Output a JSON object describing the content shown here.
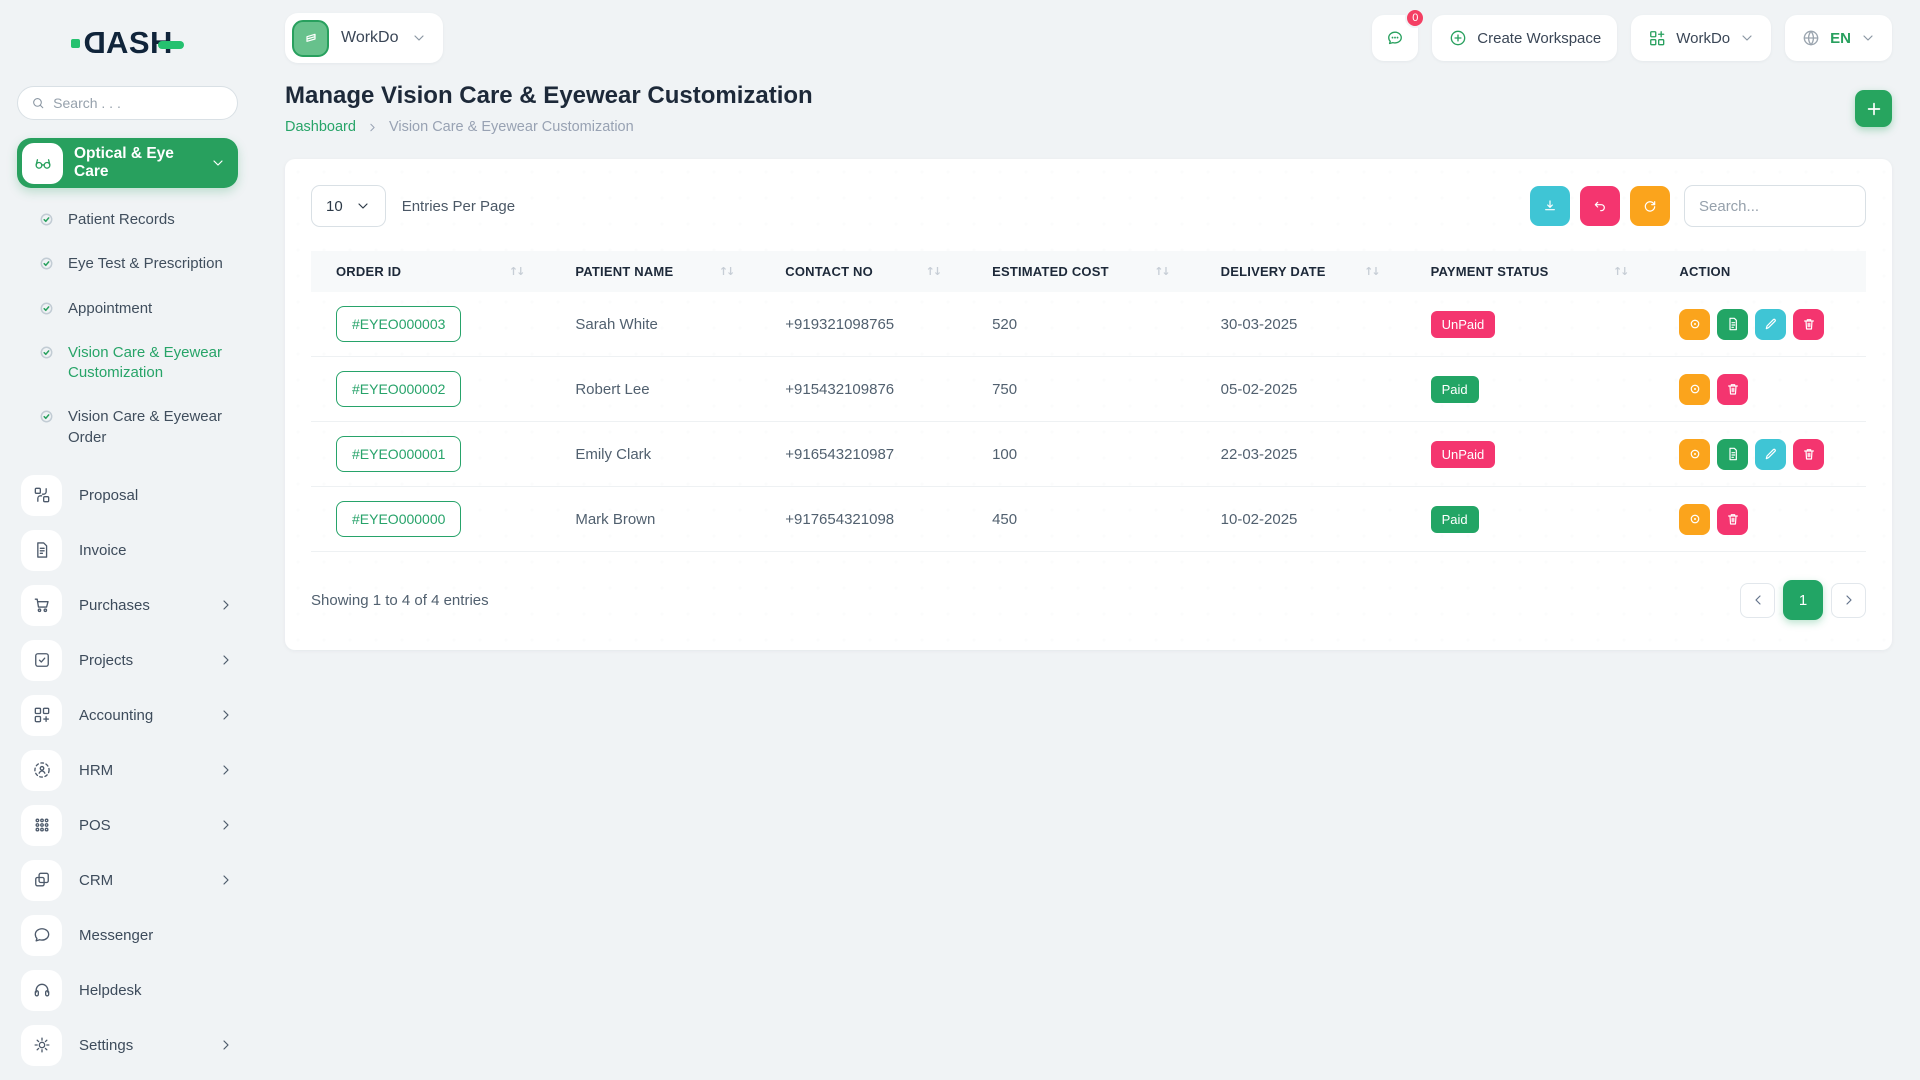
{
  "brand": {
    "name": "DASH"
  },
  "sidebar": {
    "search_placeholder": "Search . . .",
    "module": {
      "label": "Optical & Eye Care"
    },
    "submenu": [
      {
        "label": "Patient Records"
      },
      {
        "label": "Eye Test & Prescription"
      },
      {
        "label": "Appointment"
      },
      {
        "label": "Vision Care & Eyewear Customization",
        "active": true
      },
      {
        "label": "Vision Care & Eyewear Order"
      }
    ],
    "menu": [
      {
        "label": "Proposal",
        "icon": "proposal-icon",
        "has_submenu": false
      },
      {
        "label": "Invoice",
        "icon": "invoice-icon",
        "has_submenu": false
      },
      {
        "label": "Purchases",
        "icon": "purchases-icon",
        "has_submenu": true
      },
      {
        "label": "Projects",
        "icon": "projects-icon",
        "has_submenu": true
      },
      {
        "label": "Accounting",
        "icon": "accounting-icon",
        "has_submenu": true
      },
      {
        "label": "HRM",
        "icon": "hrm-icon",
        "has_submenu": true
      },
      {
        "label": "POS",
        "icon": "pos-icon",
        "has_submenu": true
      },
      {
        "label": "CRM",
        "icon": "crm-icon",
        "has_submenu": true
      },
      {
        "label": "Messenger",
        "icon": "messenger-icon",
        "has_submenu": false
      },
      {
        "label": "Helpdesk",
        "icon": "helpdesk-icon",
        "has_submenu": false
      },
      {
        "label": "Settings",
        "icon": "settings-icon",
        "has_submenu": true
      }
    ]
  },
  "topbar": {
    "workspace_label": "WorkDo",
    "chat_badge": "0",
    "create_workspace_label": "Create Workspace",
    "app_menu_label": "WorkDo",
    "language_label": "EN"
  },
  "page": {
    "title": "Manage Vision Care & Eyewear Customization",
    "breadcrumb_home": "Dashboard",
    "breadcrumb_current": "Vision Care & Eyewear Customization"
  },
  "toolbar": {
    "entries_value": "10",
    "entries_label": "Entries Per Page",
    "search_placeholder": "Search...",
    "buttons": [
      "download",
      "undo",
      "refresh"
    ]
  },
  "table": {
    "columns": [
      {
        "label": "ORDER ID",
        "sortable": true
      },
      {
        "label": "PATIENT NAME",
        "sortable": true
      },
      {
        "label": "CONTACT NO",
        "sortable": true
      },
      {
        "label": "ESTIMATED COST",
        "sortable": true
      },
      {
        "label": "DELIVERY DATE",
        "sortable": true
      },
      {
        "label": "PAYMENT STATUS",
        "sortable": true
      },
      {
        "label": "ACTION",
        "sortable": false
      }
    ],
    "sort_glyph": "↑↓",
    "rows": [
      {
        "order_id": "#EYEO000003",
        "patient": "Sarah White",
        "contact": "+919321098765",
        "cost": "520",
        "delivery": "30-03-2025",
        "status": "UnPaid",
        "actions": [
          "view",
          "invoice",
          "edit",
          "delete"
        ]
      },
      {
        "order_id": "#EYEO000002",
        "patient": "Robert Lee",
        "contact": "+915432109876",
        "cost": "750",
        "delivery": "05-02-2025",
        "status": "Paid",
        "actions": [
          "view",
          "delete"
        ]
      },
      {
        "order_id": "#EYEO000001",
        "patient": "Emily Clark",
        "contact": "+916543210987",
        "cost": "100",
        "delivery": "22-03-2025",
        "status": "UnPaid",
        "actions": [
          "view",
          "invoice",
          "edit",
          "delete"
        ]
      },
      {
        "order_id": "#EYEO000000",
        "patient": "Mark Brown",
        "contact": "+917654321098",
        "cost": "450",
        "delivery": "10-02-2025",
        "status": "Paid",
        "actions": [
          "view",
          "delete"
        ]
      }
    ],
    "footer": {
      "summary": "Showing 1 to 4 of 4 entries",
      "current_page": "1"
    }
  },
  "colors": {
    "primary_green": "#28a05e",
    "badge_paid": "#22a565",
    "badge_unpaid": "#f4356f",
    "accent_orange": "#fba41c",
    "accent_teal": "#3fc5d5",
    "accent_pink": "#f4356f",
    "page_bg": "#f0f3f5"
  }
}
